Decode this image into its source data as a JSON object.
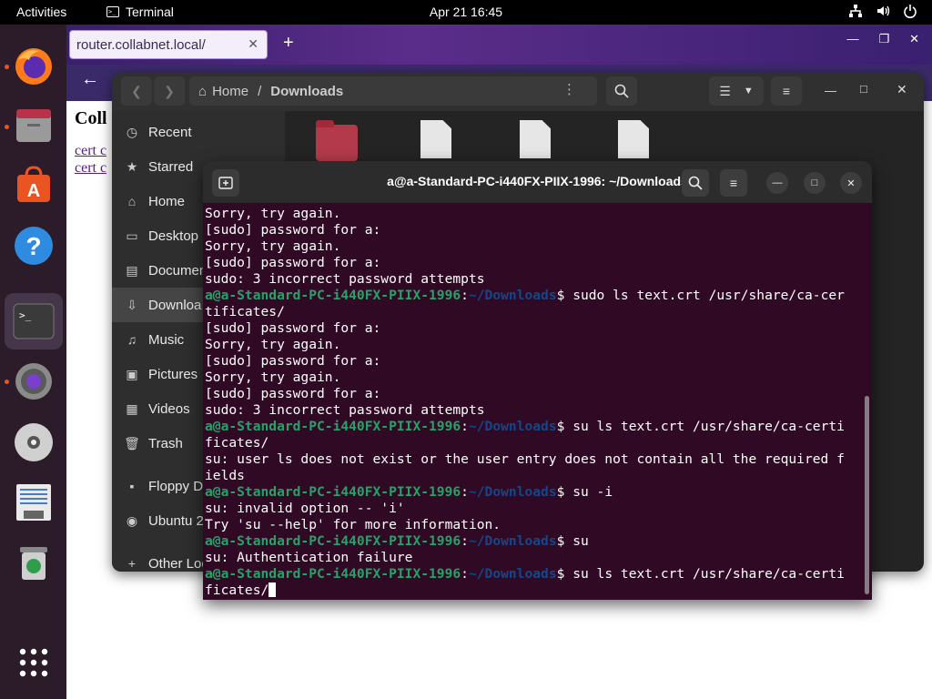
{
  "topbar": {
    "activities": "Activities",
    "app_name": "Terminal",
    "clock": "Apr 21  16:45"
  },
  "dock": {
    "items": [
      "firefox",
      "files",
      "software",
      "help",
      "terminal",
      "settings",
      "disc",
      "floppy",
      "trash",
      "apps"
    ]
  },
  "browser": {
    "tab_title": "router.collabnet.local/",
    "page_heading": "Coll",
    "links": [
      "cert c",
      "cert c"
    ]
  },
  "files": {
    "path_home": "Home",
    "path_sep": "/",
    "path_current": "Downloads",
    "sidebar": [
      {
        "label": "Recent",
        "icon": "clock-icon"
      },
      {
        "label": "Starred",
        "icon": "star-icon"
      },
      {
        "label": "Home",
        "icon": "home-icon"
      },
      {
        "label": "Desktop",
        "icon": "desktop-icon"
      },
      {
        "label": "Documen",
        "icon": "document-icon"
      },
      {
        "label": "Downloa",
        "icon": "download-icon"
      },
      {
        "label": "Music",
        "icon": "music-icon"
      },
      {
        "label": "Pictures",
        "icon": "picture-icon"
      },
      {
        "label": "Videos",
        "icon": "video-icon"
      },
      {
        "label": "Trash",
        "icon": "trash-icon"
      },
      {
        "label": "Floppy Di",
        "icon": "floppy-icon"
      },
      {
        "label": "Ubuntu 2",
        "icon": "disc-icon"
      },
      {
        "label": "Other Loc",
        "icon": "plus-icon"
      }
    ]
  },
  "terminal": {
    "title": "a@a-Standard-PC-i440FX-PIIX-1996: ~/Downloads",
    "prompt_user": "a@a-Standard-PC-i440FX-PIIX-1996",
    "prompt_sep": ":",
    "prompt_dir": "~/Downloads",
    "prompt_end": "$ ",
    "lines": [
      {
        "text": "Sorry, try again."
      },
      {
        "text": "[sudo] password for a:"
      },
      {
        "text": "Sorry, try again."
      },
      {
        "text": "[sudo] password for a:"
      },
      {
        "text": "sudo: 3 incorrect password attempts"
      },
      {
        "prompt": true,
        "cmd": "sudo ls text.crt /usr/share/ca-cer"
      },
      {
        "text": "tificates/"
      },
      {
        "text": "[sudo] password for a:"
      },
      {
        "text": "Sorry, try again."
      },
      {
        "text": "[sudo] password for a:"
      },
      {
        "text": "Sorry, try again."
      },
      {
        "text": "[sudo] password for a:"
      },
      {
        "text": "sudo: 3 incorrect password attempts"
      },
      {
        "prompt": true,
        "cmd": "su ls text.crt /usr/share/ca-certi"
      },
      {
        "text": "ficates/"
      },
      {
        "text": "su: user ls does not exist or the user entry does not contain all the required f"
      },
      {
        "text": "ields"
      },
      {
        "prompt": true,
        "cmd": "su -i"
      },
      {
        "text": "su: invalid option -- 'i'"
      },
      {
        "text": "Try 'su --help' for more information."
      },
      {
        "prompt": true,
        "cmd": "su"
      },
      {
        "text": "su: Authentication failure"
      },
      {
        "prompt": true,
        "cmd": "su ls text.crt /usr/share/ca-certi"
      },
      {
        "text": "ficates/",
        "cursor": true
      }
    ]
  }
}
